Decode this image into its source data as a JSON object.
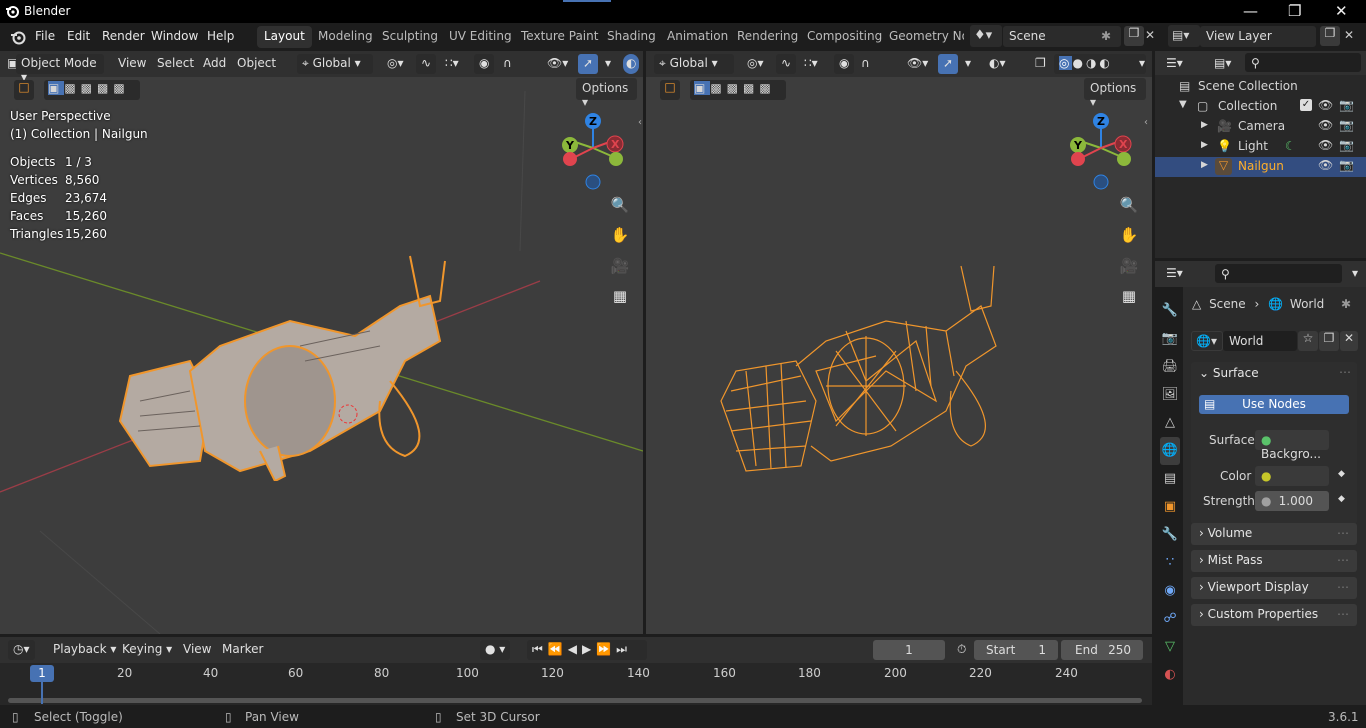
{
  "app_title": "Blender",
  "menus": [
    "File",
    "Edit",
    "Render",
    "Window",
    "Help"
  ],
  "workspaces": [
    "Layout",
    "Modeling",
    "Sculpting",
    "UV Editing",
    "Texture Paint",
    "Shading",
    "Animation",
    "Rendering",
    "Compositing",
    "Geometry Noc"
  ],
  "scene_name": "Scene",
  "view_layer": "View Layer",
  "viewport_left": {
    "mode": "Object Mode",
    "menus": [
      "View",
      "Select",
      "Add",
      "Object"
    ],
    "orientation": "Global",
    "options": "Options",
    "perspective": "User Perspective",
    "collection": "(1) Collection | Nailgun",
    "stats": [
      {
        "label": "Objects",
        "value": "1 / 3"
      },
      {
        "label": "Vertices",
        "value": "8,560"
      },
      {
        "label": "Edges",
        "value": "23,674"
      },
      {
        "label": "Faces",
        "value": "15,260"
      },
      {
        "label": "Triangles",
        "value": "15,260"
      }
    ]
  },
  "viewport_right": {
    "orientation": "Global",
    "options": "Options"
  },
  "gizmo": {
    "z": "Z",
    "y": "Y",
    "x": "X"
  },
  "outliner": {
    "root": "Scene Collection",
    "collection": "Collection",
    "items": [
      "Camera",
      "Light",
      "Nailgun"
    ]
  },
  "properties": {
    "breadcrumb_scene": "Scene",
    "breadcrumb_world": "World",
    "world_name": "World",
    "surface_header": "Surface",
    "use_nodes": "Use Nodes",
    "surface_label": "Surface",
    "surface_value": "Backgro...",
    "color_label": "Color",
    "strength_label": "Strength",
    "strength_value": "1.000",
    "sections": [
      "Volume",
      "Mist Pass",
      "Viewport Display",
      "Custom Properties"
    ]
  },
  "timeline": {
    "menus": [
      "Playback",
      "Keying",
      "View",
      "Marker"
    ],
    "current_frame": "1",
    "start_label": "Start",
    "start": "1",
    "end_label": "End",
    "end": "250",
    "ticks": [
      "20",
      "40",
      "60",
      "80",
      "100",
      "120",
      "140",
      "160",
      "180",
      "200",
      "220",
      "240"
    ],
    "playhead": "1"
  },
  "status": {
    "select": "Select (Toggle)",
    "pan": "Pan View",
    "cursor": "Set 3D Cursor",
    "version": "3.6.1"
  },
  "colors": {
    "accent": "#4772b3",
    "selection": "#f0962c",
    "active_text": "#ffaf29"
  }
}
